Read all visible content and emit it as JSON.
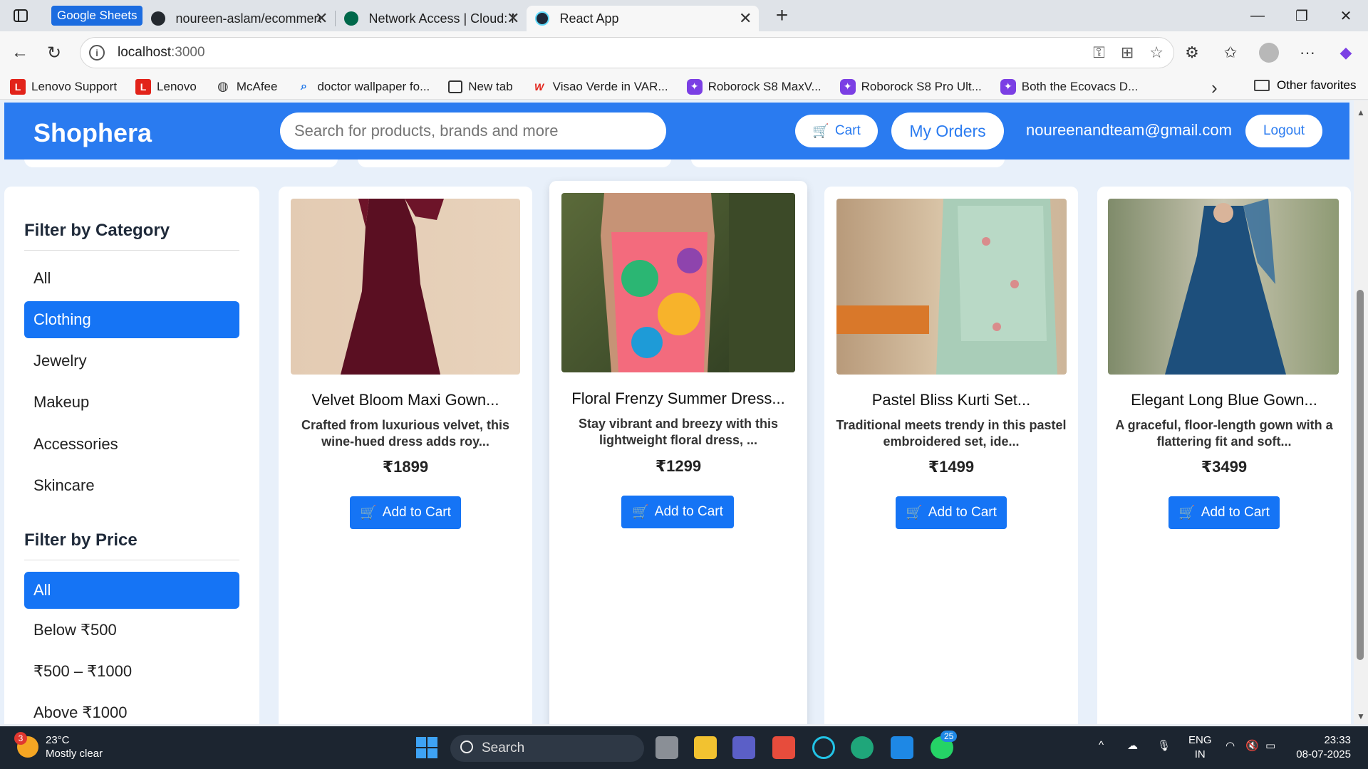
{
  "browser": {
    "tab_group_label": "Google Sheets",
    "tabs": [
      {
        "title": "noureen-aslam/ecommerce-prod",
        "favicon_color": "#24292f"
      },
      {
        "title": "Network Access | Cloud: MongoD",
        "favicon_color": "#00684a"
      },
      {
        "title": "React App",
        "favicon_color": "#61dafb",
        "active": true
      }
    ],
    "close_glyph": "✕",
    "new_tab_glyph": "+",
    "url_host": "localhost",
    "url_port": ":3000",
    "bookmarks": [
      {
        "label": "Lenovo Support",
        "icon": "lenovo-icon",
        "color": "#e2231a"
      },
      {
        "label": "Lenovo",
        "icon": "lenovo-icon",
        "color": "#e2231a"
      },
      {
        "label": "McAfee",
        "icon": "globe-icon",
        "color": "#333333"
      },
      {
        "label": "doctor wallpaper fo...",
        "icon": "search-icon",
        "color": "#1a73e8"
      },
      {
        "label": "New tab",
        "icon": "newtab-icon",
        "color": "#333333"
      },
      {
        "label": "Visao Verde in VAR...",
        "icon": "w-logo-icon",
        "color": "#e2231a"
      },
      {
        "label": "Roborock S8 MaxV...",
        "icon": "copilot-icon",
        "color": "#7b3fe4"
      },
      {
        "label": "Roborock S8 Pro Ult...",
        "icon": "copilot-icon",
        "color": "#7b3fe4"
      },
      {
        "label": "Both the Ecovacs D...",
        "icon": "copilot-icon",
        "color": "#7b3fe4"
      }
    ],
    "other_favorites": "Other favorites"
  },
  "app": {
    "brand": "Shophera",
    "search_placeholder": "Search for products, brands and more",
    "cart_label": "Cart",
    "cart_icon": "🛒",
    "orders_label": "My Orders",
    "user_email": "noureenandteam@gmail.com",
    "logout_label": "Logout",
    "accent_color": "#2a7bf0"
  },
  "filters": {
    "category_title": "Filter by Category",
    "categories": [
      "All",
      "Clothing",
      "Jewelry",
      "Makeup",
      "Accessories",
      "Skincare"
    ],
    "selected_category": "Clothing",
    "price_title": "Filter by Price",
    "prices": [
      "All",
      "Below ₹500",
      "₹500 – ₹1000",
      "Above ₹1000"
    ],
    "selected_price": "All"
  },
  "products": [
    {
      "name": "Velvet Bloom Maxi Gown...",
      "desc": "Crafted from luxurious velvet, this wine-hued dress adds roy...",
      "price": "₹1899",
      "button": "Add to Cart"
    },
    {
      "name": "Floral Frenzy Summer Dress...",
      "desc": "Stay vibrant and breezy with this lightweight floral dress, ...",
      "price": "₹1299",
      "button": "Add to Cart"
    },
    {
      "name": "Pastel Bliss Kurti Set...",
      "desc": "Traditional meets trendy in this pastel embroidered set, ide...",
      "price": "₹1499",
      "button": "Add to Cart"
    },
    {
      "name": "Elegant Long Blue Gown...",
      "desc": "A graceful, floor-length gown with a flattering fit and soft...",
      "price": "₹3499",
      "button": "Add to Cart"
    }
  ],
  "taskbar": {
    "weather_temp": "23°C",
    "weather_desc": "Mostly clear",
    "weather_badge": "3",
    "search_label": "Search",
    "whatsapp_badge": "25",
    "lang_top": "ENG",
    "lang_bottom": "IN",
    "time": "23:33",
    "date": "08-07-2025"
  }
}
